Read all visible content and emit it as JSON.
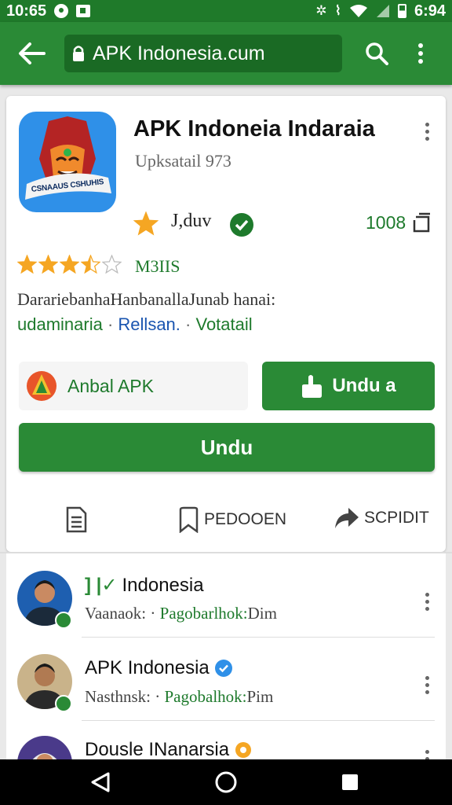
{
  "status_bar": {
    "time": "10:65",
    "clock_right": "6:94",
    "icons": [
      "circle-dot-icon",
      "square-icon",
      "bluetooth-icon",
      "vibrate-icon",
      "wifi-icon",
      "signal-icon",
      "battery-icon"
    ]
  },
  "toolbar": {
    "url": "APK Indonesia.cum",
    "icons": [
      "back-arrow-icon",
      "lock-icon",
      "search-icon",
      "more-vert-icon"
    ]
  },
  "app": {
    "title": "APK Indoneia Indaraia",
    "subtitle": "Upksatail 973",
    "icon_text": "CSNAAUS CSHUHIS",
    "developer": "J,duv",
    "count": "1008",
    "rating": 3.5,
    "rating_text": "M3IIS",
    "description": "DarariebanhaHanbanallaJunab hanai:",
    "tags": [
      "udaminaria",
      "Rellsan.",
      "Votatail"
    ],
    "tag_separator": "·",
    "apk_button": "Anbal APK",
    "download_small": "Undu a",
    "download_large": "Undu"
  },
  "actions": [
    {
      "label": "",
      "icon": "document-icon"
    },
    {
      "label": "PEDOOEN",
      "icon": "bookmark-icon"
    },
    {
      "label": "SCPIDIT",
      "icon": "share-arrow-icon"
    }
  ],
  "list_items": [
    {
      "title": "Indonesia",
      "title_prefix": "] |✓",
      "sub_dark": "Vaanaok:",
      "sub_sep": "·",
      "sub_green": "Pagobarlhok:",
      "sub_tail": "Dim"
    },
    {
      "title": "APK Indonesia",
      "title_prefix": "",
      "sub_dark": "Nasthnsk:",
      "sub_sep": "·",
      "sub_green": "Pagobalhok:",
      "sub_tail": "Pim"
    },
    {
      "title": "Dousle INanarsia",
      "title_prefix": "",
      "sub_dark": "",
      "sub_sep": "",
      "sub_green": "",
      "sub_tail": ""
    }
  ],
  "colors": {
    "primary_green": "#2a8a36",
    "dark_green": "#1f7a2a",
    "link_blue": "#1a55b0",
    "star_orange": "#f5a623"
  }
}
